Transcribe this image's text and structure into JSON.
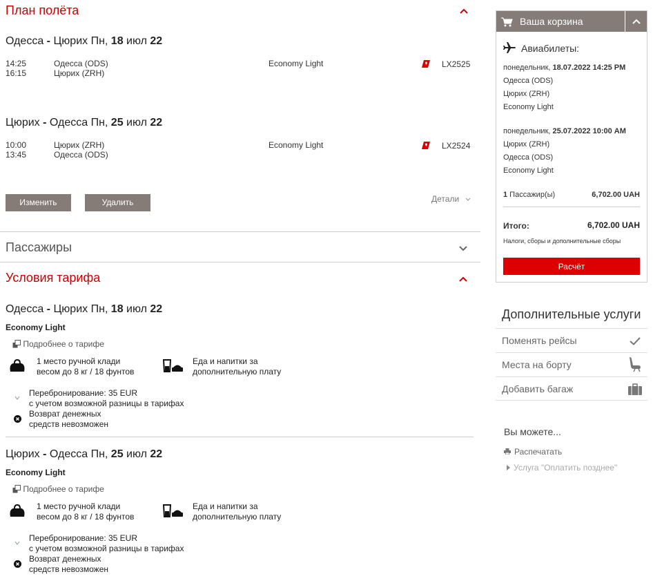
{
  "flight_plan": {
    "title": "План полёта",
    "legs": [
      {
        "route_from": "Одесса",
        "route_sep": " - ",
        "route_to": "Цюрих",
        "weekday": " Пн, ",
        "day": "18",
        "month": " июл ",
        "year": "22",
        "dep_time": "14:25",
        "arr_time": "16:15",
        "dep_airport": "Одесса (ODS)",
        "arr_airport": "Цюрих (ZRH)",
        "fare_class": "Economy Light",
        "flight_no": "LX2525"
      },
      {
        "route_from": "Цюрих",
        "route_sep": " - ",
        "route_to": "Одесса",
        "weekday": " Пн, ",
        "day": "25",
        "month": " июл ",
        "year": "22",
        "dep_time": "10:00",
        "arr_time": "13:45",
        "dep_airport": "Цюрих (ZRH)",
        "arr_airport": "Одесса (ODS)",
        "fare_class": "Economy Light",
        "flight_no": "LX2524"
      }
    ],
    "change_label": "Изменить",
    "delete_label": "Удалить",
    "details_label": "Детали"
  },
  "passengers": {
    "title": "Пассажиры"
  },
  "fare_conditions": {
    "title": "Условия тарифа",
    "legs": [
      {
        "route_from": "Одесса",
        "route_sep": " - ",
        "route_to": "Цюрих",
        "weekday": " Пн, ",
        "day": "18",
        "month": " июл ",
        "year": "22",
        "fare_name": "Economy Light",
        "fare_more": "Подробнее о тарифе",
        "baggage_1": "1 место ручной клади",
        "baggage_2": "весом до 8 кг / 18 фунтов",
        "food_1": "Еда и напитки за",
        "food_2": "дополнительную плату",
        "rebook_1": "Перебронирование: 35 EUR",
        "rebook_2": "с учетом возможной разницы в тарифах",
        "refund_1": "Возврат денежных",
        "refund_2": "средств невозможен"
      },
      {
        "route_from": "Цюрих",
        "route_sep": " - ",
        "route_to": "Одесса",
        "weekday": " Пн, ",
        "day": "25",
        "month": " июл ",
        "year": "22",
        "fare_name": "Economy Light",
        "fare_more": "Подробнее о тарифе",
        "baggage_1": "1 место ручной клади",
        "baggage_2": "весом до 8 кг / 18 фунтов",
        "food_1": "Еда и напитки за",
        "food_2": "дополнительную плату",
        "rebook_1": "Перебронирование: 35 EUR",
        "rebook_2": "с учетом возможной разницы в тарифах",
        "refund_1": "Возврат денежных",
        "refund_2": "средств невозможен"
      }
    ]
  },
  "cart": {
    "title": "Ваша корзина",
    "tickets_label": "Авиабилеты:",
    "legs": [
      {
        "weekday": "понедельник, ",
        "datetime": "18.07.2022 14:25 PM",
        "from": "Одесса (ODS)",
        "to": "Цюрих (ZRH)",
        "fare": "Economy Light"
      },
      {
        "weekday": "понедельник, ",
        "datetime": "25.07.2022 10:00 AM",
        "from": "Цюрих (ZRH)",
        "to": "Одесса (ODS)",
        "fare": "Economy Light"
      }
    ],
    "pax_count": "1",
    "pax_label": " Пассажир(ы)",
    "pax_price": "6,702.00 UAH",
    "total_label": "Итого:",
    "total_price": "6,702.00 UAH",
    "taxes_note": "Налоги, сборы и дополнительные сборы",
    "checkout_label": "Расчёт"
  },
  "extra_services": {
    "title": "Дополнительные услуги",
    "items": [
      {
        "label": "Поменять рейсы",
        "icon": "check-icon"
      },
      {
        "label": "Места на борту",
        "icon": "seat-icon"
      },
      {
        "label": "Добавить багаж",
        "icon": "suitcase-icon"
      }
    ]
  },
  "you_can": {
    "title": "Вы можете...",
    "print_label": "Распечатать",
    "pay_later_label": "Услуга \"Оплатить позднее\""
  },
  "colors": {
    "accent": "#cc0000",
    "button_grey": "#857c78"
  }
}
